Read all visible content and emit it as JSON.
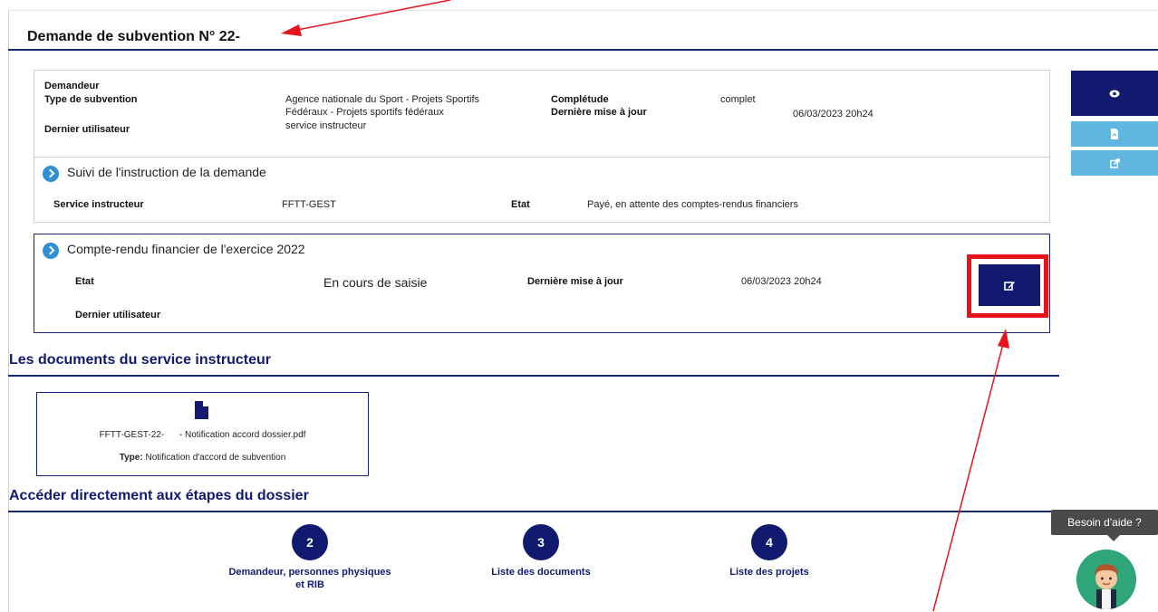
{
  "page": {
    "title": "Demande de subvention N° 22-"
  },
  "summary": {
    "demandeur_label": "Demandeur",
    "type_label": "Type de subvention",
    "type_value_line1": "Agence nationale du Sport - Projets Sportifs",
    "type_value_line2": "Fédéraux - Projets sportifs fédéraux",
    "dernier_utilisateur_label": "Dernier utilisateur",
    "dernier_utilisateur_value": "service instructeur",
    "completude_label": "Complétude",
    "completude_value": "complet",
    "maj_label": "Dernière mise à jour",
    "maj_value": "06/03/2023 20h24"
  },
  "suivi": {
    "title": "Suivi de l'instruction de la demande",
    "service_label": "Service instructeur",
    "service_value": "FFTT-GEST",
    "etat_label": "Etat",
    "etat_value": "Payé, en attente des comptes-rendus financiers"
  },
  "compte_rendu": {
    "title": "Compte-rendu financier de l'exercice 2022",
    "etat_label": "Etat",
    "etat_value": "En cours de saisie",
    "maj_label": "Dernière mise à jour",
    "maj_value": "06/03/2023 20h24",
    "dernier_utilisateur_label": "Dernier utilisateur"
  },
  "documents": {
    "heading": "Les documents du service instructeur",
    "file_prefix": "FFTT-GEST-22-",
    "file_suffix": "- Notification accord dossier.pdf",
    "type_label": "Type:",
    "type_value": "Notification d'accord de subvention"
  },
  "steps": {
    "heading": "Accéder directement aux étapes du dossier",
    "items": [
      {
        "number": "2",
        "label_line1": "Demandeur, personnes physiques",
        "label_line2": "et RIB"
      },
      {
        "number": "3",
        "label_line1": "Liste des documents",
        "label_line2": ""
      },
      {
        "number": "4",
        "label_line1": "Liste des projets",
        "label_line2": ""
      }
    ]
  },
  "help": {
    "label": "Besoin d'aide ?"
  },
  "colors": {
    "navy": "#111a6e",
    "light_blue": "#5fb6de",
    "annotation_red": "#e8141b"
  },
  "icons": [
    "eye-icon",
    "document-icon",
    "share-icon",
    "edit-icon",
    "file-icon",
    "chevron-right-icon"
  ]
}
